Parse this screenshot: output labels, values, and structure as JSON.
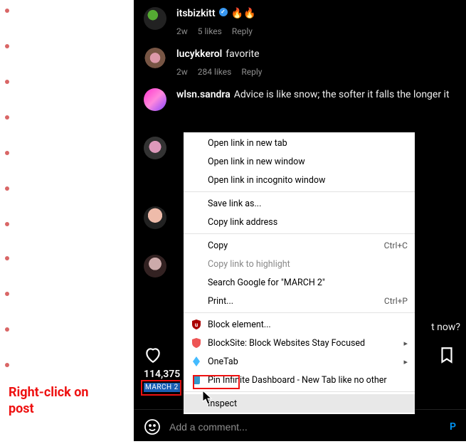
{
  "annotation": {
    "text": "Right-click on\npost"
  },
  "comments": [
    {
      "user": "itsbizkitt",
      "verified": true,
      "text": "🔥🔥",
      "age": "2w",
      "likes": "5 likes",
      "reply": "Reply"
    },
    {
      "user": "lucykkerol",
      "verified": false,
      "text": "favorite",
      "age": "2w",
      "likes": "284 likes",
      "reply": "Reply"
    },
    {
      "user": "wlsn.sandra",
      "verified": false,
      "text": "Advice is like snow; the softer it falls the longer it",
      "age": "",
      "likes": "",
      "reply": ""
    }
  ],
  "partial_comment_tail": "t now?",
  "action_bar": {
    "likes_count": "114,375",
    "post_date": "MARCH 2"
  },
  "add_comment": {
    "placeholder": "Add a comment...",
    "post_label": "P"
  },
  "context_menu": {
    "items": [
      {
        "label": "Open link in new tab",
        "type": "item"
      },
      {
        "label": "Open link in new window",
        "type": "item"
      },
      {
        "label": "Open link in incognito window",
        "type": "item"
      },
      {
        "type": "sep"
      },
      {
        "label": "Save link as...",
        "type": "item"
      },
      {
        "label": "Copy link address",
        "type": "item"
      },
      {
        "type": "sep"
      },
      {
        "label": "Copy",
        "shortcut": "Ctrl+C",
        "type": "item"
      },
      {
        "label": "Copy link to highlight",
        "type": "item",
        "disabled": true
      },
      {
        "label": "Search Google for \"MARCH 2\"",
        "type": "item"
      },
      {
        "label": "Print...",
        "shortcut": "Ctrl+P",
        "type": "item"
      },
      {
        "type": "sep"
      },
      {
        "label": "Block element...",
        "icon": "ublock",
        "type": "item"
      },
      {
        "label": "BlockSite: Block Websites  Stay Focused",
        "icon": "blocksite",
        "submenu": true,
        "type": "item"
      },
      {
        "label": "OneTab",
        "icon": "onetab",
        "submenu": true,
        "type": "item"
      },
      {
        "label": "Pin Infinite Dashboard - New Tab like no other",
        "icon": "infinite",
        "type": "item"
      },
      {
        "type": "sep"
      },
      {
        "label": "Inspect",
        "type": "item",
        "hovered": true
      }
    ]
  }
}
